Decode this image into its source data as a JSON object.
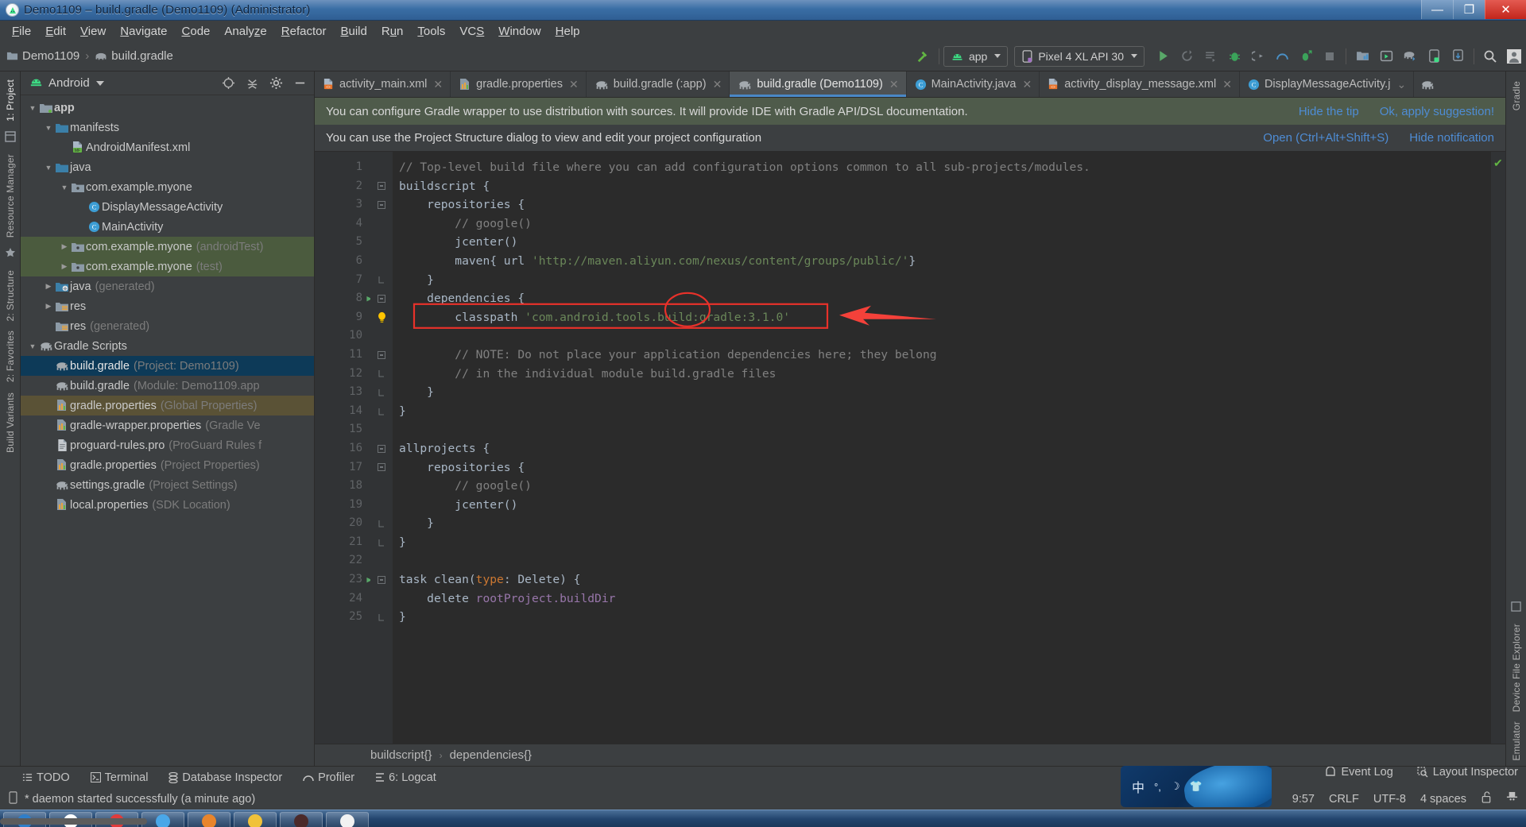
{
  "window": {
    "title": "Demo1109 – build.gradle (Demo1109) (Administrator)",
    "app_icon": "android-studio-icon",
    "minimize": "—",
    "maximize": "❐",
    "close": "✕"
  },
  "menubar": [
    {
      "label": "File",
      "mnemonic": "F"
    },
    {
      "label": "Edit",
      "mnemonic": "E"
    },
    {
      "label": "View",
      "mnemonic": "V"
    },
    {
      "label": "Navigate",
      "mnemonic": "N"
    },
    {
      "label": "Code",
      "mnemonic": "C"
    },
    {
      "label": "Analyze",
      "mnemonic": "z"
    },
    {
      "label": "Refactor",
      "mnemonic": "R"
    },
    {
      "label": "Build",
      "mnemonic": "B"
    },
    {
      "label": "Run",
      "mnemonic": "u"
    },
    {
      "label": "Tools",
      "mnemonic": "T"
    },
    {
      "label": "VCS",
      "mnemonic": "S"
    },
    {
      "label": "Window",
      "mnemonic": "W"
    },
    {
      "label": "Help",
      "mnemonic": "H"
    }
  ],
  "toolbar": {
    "breadcrumb": {
      "project": "Demo1109",
      "file": "build.gradle"
    },
    "module_selector": "app",
    "device_selector": "Pixel 4 XL API 30",
    "icons": [
      "run-icon",
      "rerun-icon",
      "apply-changes-icon",
      "debug-icon",
      "attach-debugger-icon",
      "profiler-icon",
      "run-with-coverage-icon",
      "stop-icon",
      "sdk-manager-icon",
      "avd-manager-icon",
      "sync-gradle-icon",
      "device-file-explorer-icon",
      "download-icon",
      "search-icon",
      "user-account-icon"
    ]
  },
  "project_panel": {
    "title": "Android",
    "header_icons": [
      "locate-icon",
      "collapse-all-icon",
      "settings-gear-icon",
      "hide-icon"
    ],
    "tree": [
      {
        "depth": 0,
        "arrow": "down",
        "icon": "module-folder-icon",
        "label": "app",
        "bold": true,
        "sub": "",
        "state": "normal"
      },
      {
        "depth": 1,
        "arrow": "down",
        "icon": "folder-blue-icon",
        "label": "manifests",
        "sub": "",
        "state": "normal"
      },
      {
        "depth": 2,
        "arrow": "none",
        "icon": "manifest-file-icon",
        "label": "AndroidManifest.xml",
        "sub": "",
        "state": "normal"
      },
      {
        "depth": 1,
        "arrow": "down",
        "icon": "folder-blue-icon",
        "label": "java",
        "sub": "",
        "state": "normal"
      },
      {
        "depth": 2,
        "arrow": "down",
        "icon": "package-icon",
        "label": "com.example.myone",
        "sub": "",
        "state": "normal"
      },
      {
        "depth": 3,
        "arrow": "none",
        "icon": "class-icon",
        "label": "DisplayMessageActivity",
        "sub": "",
        "state": "normal"
      },
      {
        "depth": 3,
        "arrow": "none",
        "icon": "class-icon",
        "label": "MainActivity",
        "sub": "",
        "state": "normal"
      },
      {
        "depth": 2,
        "arrow": "right",
        "icon": "package-icon",
        "label": "com.example.myone",
        "sub": "(androidTest)",
        "state": "green"
      },
      {
        "depth": 2,
        "arrow": "right",
        "icon": "package-icon",
        "label": "com.example.myone",
        "sub": "(test)",
        "state": "green"
      },
      {
        "depth": 1,
        "arrow": "right",
        "icon": "folder-generated-icon",
        "label": "java",
        "sub": "(generated)",
        "state": "normal"
      },
      {
        "depth": 1,
        "arrow": "right",
        "icon": "folder-res-icon",
        "label": "res",
        "sub": "",
        "state": "normal"
      },
      {
        "depth": 1,
        "arrow": "none",
        "icon": "folder-res-icon",
        "label": "res",
        "sub": "(generated)",
        "state": "normal"
      },
      {
        "depth": 0,
        "arrow": "down",
        "icon": "gradle-elephant-icon",
        "label": "Gradle Scripts",
        "sub": "",
        "state": "normal"
      },
      {
        "depth": 1,
        "arrow": "none",
        "icon": "gradle-elephant-icon",
        "label": "build.gradle",
        "sub": "(Project: Demo1109)",
        "state": "selected"
      },
      {
        "depth": 1,
        "arrow": "none",
        "icon": "gradle-elephant-icon",
        "label": "build.gradle",
        "sub": "(Module: Demo1109.app",
        "state": "normal"
      },
      {
        "depth": 1,
        "arrow": "none",
        "icon": "properties-icon",
        "label": "gradle.properties",
        "sub": "(Global Properties)",
        "state": "brown"
      },
      {
        "depth": 1,
        "arrow": "none",
        "icon": "properties-icon",
        "label": "gradle-wrapper.properties",
        "sub": "(Gradle Ve",
        "state": "normal"
      },
      {
        "depth": 1,
        "arrow": "none",
        "icon": "text-file-icon",
        "label": "proguard-rules.pro",
        "sub": "(ProGuard Rules f",
        "state": "normal"
      },
      {
        "depth": 1,
        "arrow": "none",
        "icon": "properties-icon",
        "label": "gradle.properties",
        "sub": "(Project Properties)",
        "state": "normal"
      },
      {
        "depth": 1,
        "arrow": "none",
        "icon": "gradle-elephant-icon",
        "label": "settings.gradle",
        "sub": "(Project Settings)",
        "state": "normal"
      },
      {
        "depth": 1,
        "arrow": "none",
        "icon": "properties-icon",
        "label": "local.properties",
        "sub": "(SDK Location)",
        "state": "normal"
      }
    ]
  },
  "left_strips": {
    "top": [
      "1: Project"
    ],
    "items": [
      "Resource Manager",
      "2: Structure",
      "2: Favorites",
      "Build Variants"
    ]
  },
  "right_strips": {
    "items": [
      "Gradle",
      "Device File Explorer",
      "Emulator"
    ]
  },
  "editor_tabs": [
    {
      "label": "activity_main.xml",
      "icon": "layout-xml-icon",
      "active": false,
      "closable": true
    },
    {
      "label": "gradle.properties",
      "icon": "properties-icon",
      "active": false,
      "closable": true
    },
    {
      "label": "build.gradle (:app)",
      "icon": "gradle-elephant-icon",
      "active": false,
      "closable": true
    },
    {
      "label": "build.gradle (Demo1109)",
      "icon": "gradle-elephant-icon",
      "active": true,
      "closable": true
    },
    {
      "label": "MainActivity.java",
      "icon": "class-icon",
      "active": false,
      "closable": true
    },
    {
      "label": "activity_display_message.xml",
      "icon": "layout-xml-icon",
      "active": false,
      "closable": true
    },
    {
      "label": "DisplayMessageActivity.j",
      "icon": "class-icon",
      "active": false,
      "closable": false
    }
  ],
  "notifications": [
    {
      "text": "You can configure Gradle wrapper to use distribution with sources. It will provide IDE with Gradle API/DSL documentation.",
      "actions": [
        "Hide the tip",
        "Ok, apply suggestion!"
      ]
    },
    {
      "text": "You can use the Project Structure dialog to view and edit your project configuration",
      "actions": [
        "Open (Ctrl+Alt+Shift+S)",
        "Hide notification"
      ]
    }
  ],
  "editor": {
    "line_numbers": [
      1,
      2,
      3,
      4,
      5,
      6,
      7,
      8,
      9,
      10,
      11,
      12,
      13,
      14,
      15,
      16,
      17,
      18,
      19,
      20,
      21,
      22,
      23,
      24,
      25
    ],
    "lines": [
      {
        "n": 1,
        "indent": 0,
        "segs": [
          {
            "t": "// Top-level build file where you can add configuration options common to all sub-projects/modules.",
            "c": "cm"
          }
        ],
        "fold": "none",
        "run": false
      },
      {
        "n": 2,
        "indent": 0,
        "segs": [
          {
            "t": "buildscript {",
            "c": "pl"
          }
        ],
        "fold": "open",
        "run": false
      },
      {
        "n": 3,
        "indent": 1,
        "segs": [
          {
            "t": "repositories {",
            "c": "pl"
          }
        ],
        "fold": "open",
        "run": false
      },
      {
        "n": 4,
        "indent": 2,
        "segs": [
          {
            "t": "// google()",
            "c": "cm"
          }
        ],
        "fold": "none",
        "run": false
      },
      {
        "n": 5,
        "indent": 2,
        "segs": [
          {
            "t": "jcenter()",
            "c": "pl"
          }
        ],
        "fold": "none",
        "run": false
      },
      {
        "n": 6,
        "indent": 2,
        "segs": [
          {
            "t": "maven{ url ",
            "c": "pl"
          },
          {
            "t": "'http://maven.aliyun.com/nexus/content/groups/public/'",
            "c": "str"
          },
          {
            "t": "}",
            "c": "pl"
          }
        ],
        "fold": "none",
        "run": false
      },
      {
        "n": 7,
        "indent": 1,
        "segs": [
          {
            "t": "}",
            "c": "pl"
          }
        ],
        "fold": "close",
        "run": false
      },
      {
        "n": 8,
        "indent": 1,
        "segs": [
          {
            "t": "dependencies {",
            "c": "pl"
          }
        ],
        "fold": "open",
        "run": true
      },
      {
        "n": 9,
        "indent": 2,
        "segs": [
          {
            "t": "classpath ",
            "c": "pl"
          },
          {
            "t": "'com.android.tools.build:gradle:3.1.0'",
            "c": "str"
          }
        ],
        "fold": "none",
        "run": false,
        "bulb": true
      },
      {
        "n": 10,
        "indent": 0,
        "segs": [],
        "fold": "none",
        "run": false
      },
      {
        "n": 11,
        "indent": 2,
        "segs": [
          {
            "t": "// NOTE: Do not place your application dependencies here; they belong",
            "c": "cm"
          }
        ],
        "fold": "open",
        "run": false
      },
      {
        "n": 12,
        "indent": 2,
        "segs": [
          {
            "t": "// in the individual module build.gradle files",
            "c": "cm"
          }
        ],
        "fold": "close",
        "run": false
      },
      {
        "n": 13,
        "indent": 1,
        "segs": [
          {
            "t": "}",
            "c": "pl"
          }
        ],
        "fold": "close",
        "run": false
      },
      {
        "n": 14,
        "indent": 0,
        "segs": [
          {
            "t": "}",
            "c": "pl"
          }
        ],
        "fold": "close",
        "run": false
      },
      {
        "n": 15,
        "indent": 0,
        "segs": [],
        "fold": "none",
        "run": false
      },
      {
        "n": 16,
        "indent": 0,
        "segs": [
          {
            "t": "allprojects {",
            "c": "pl"
          }
        ],
        "fold": "open",
        "run": false
      },
      {
        "n": 17,
        "indent": 1,
        "segs": [
          {
            "t": "repositories {",
            "c": "pl"
          }
        ],
        "fold": "open",
        "run": false
      },
      {
        "n": 18,
        "indent": 2,
        "segs": [
          {
            "t": "// google()",
            "c": "cm"
          }
        ],
        "fold": "none",
        "run": false
      },
      {
        "n": 19,
        "indent": 2,
        "segs": [
          {
            "t": "jcenter()",
            "c": "pl"
          }
        ],
        "fold": "none",
        "run": false
      },
      {
        "n": 20,
        "indent": 1,
        "segs": [
          {
            "t": "}",
            "c": "pl"
          }
        ],
        "fold": "close",
        "run": false
      },
      {
        "n": 21,
        "indent": 0,
        "segs": [
          {
            "t": "}",
            "c": "pl"
          }
        ],
        "fold": "close",
        "run": false
      },
      {
        "n": 22,
        "indent": 0,
        "segs": [],
        "fold": "none",
        "run": false
      },
      {
        "n": 23,
        "indent": 0,
        "segs": [
          {
            "t": "task clean(",
            "c": "pl"
          },
          {
            "t": "type",
            "c": "kw"
          },
          {
            "t": ": Delete) {",
            "c": "pl"
          }
        ],
        "fold": "open",
        "run": true
      },
      {
        "n": 24,
        "indent": 1,
        "segs": [
          {
            "t": "delete ",
            "c": "pl"
          },
          {
            "t": "rootProject.buildDir",
            "c": "fld"
          }
        ],
        "fold": "none",
        "run": false
      },
      {
        "n": 25,
        "indent": 0,
        "segs": [
          {
            "t": "}",
            "c": "pl"
          }
        ],
        "fold": "close",
        "run": false
      }
    ],
    "inspection_status": "ok-check-icon",
    "annotations": {
      "highlight_box_line": 9,
      "circle_target": "3.1.0",
      "arrow": "red-left-arrow",
      "box_color": "#e8312a",
      "arrow_color": "#f4413a"
    }
  },
  "breadcrumb_bar": {
    "items": [
      "buildscript{}",
      "dependencies{}"
    ],
    "separator": "›"
  },
  "bottom_toolwindows": [
    {
      "label": "TODO",
      "icon": "todo-icon"
    },
    {
      "label": "Terminal",
      "icon": "terminal-icon"
    },
    {
      "label": "Database Inspector",
      "icon": "database-icon"
    },
    {
      "label": "Profiler",
      "icon": "profiler-icon"
    },
    {
      "label": "6: Logcat",
      "icon": "logcat-icon"
    }
  ],
  "statusbar": {
    "icon": "memory-indicator-icon",
    "message": "* daemon started successfully (a minute ago)",
    "right_top": [
      {
        "label": "Event Log",
        "icon": "event-log-icon"
      },
      {
        "label": "Layout Inspector",
        "icon": "layout-inspector-icon"
      }
    ],
    "right_bottom": [
      "9:57",
      "CRLF",
      "UTF-8",
      "4 spaces"
    ],
    "right_icons": [
      "unlocked-padlock-icon",
      "inspector-hat-icon"
    ],
    "ime_widget": {
      "glyphs": [
        "中",
        "°,",
        "☽",
        "👕"
      ],
      "name": "ime-floating-bar"
    }
  },
  "taskbar": {
    "items": [
      "item-1",
      "item-2",
      "item-3",
      "item-4",
      "item-5",
      "item-6",
      "item-7",
      "item-8"
    ]
  },
  "colors": {
    "accent_blue": "#4a88c7",
    "link_blue": "#4e8cd4",
    "notif_green": "#4f5b4b",
    "selection_blue": "#0d3a58",
    "annotation_red": "#e8312a",
    "string_green": "#6a8759",
    "comment_gray": "#808080",
    "keyword_orange": "#cc7832"
  }
}
